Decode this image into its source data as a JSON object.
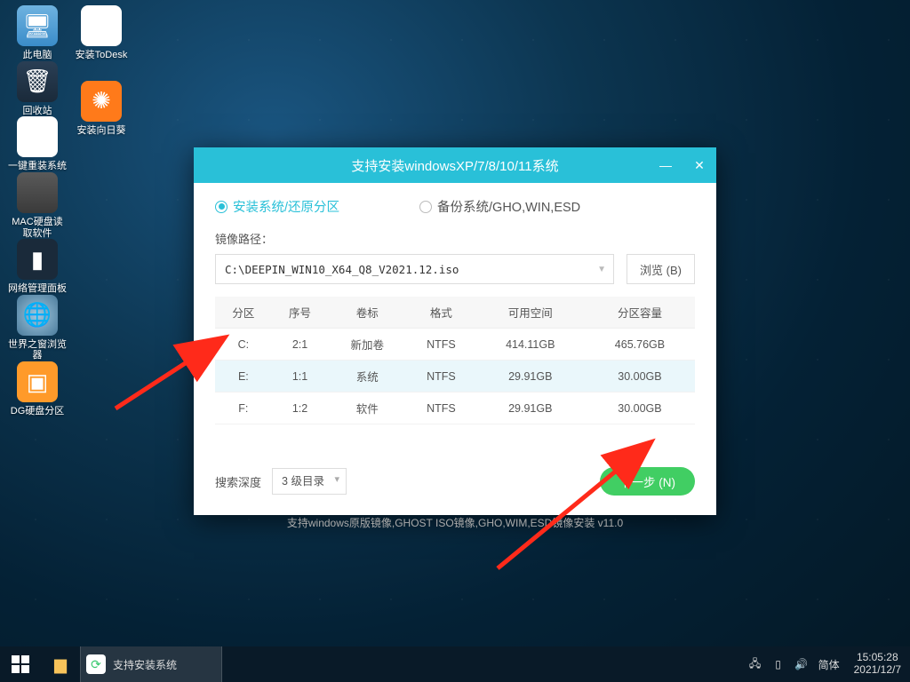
{
  "desktop": {
    "col1": [
      {
        "label": "此电脑",
        "icon": "ic-pc",
        "glyph": "🖥"
      },
      {
        "label": "回收站",
        "icon": "ic-recycle",
        "glyph": "🗑"
      },
      {
        "label": "一键重装系统",
        "icon": "ic-reinstall",
        "glyph": "⟳"
      },
      {
        "label": "MAC硬盘读取软件",
        "icon": "ic-mac",
        "glyph": ""
      },
      {
        "label": "网络管理面板",
        "icon": "ic-netpanel",
        "glyph": "▮"
      },
      {
        "label": "世界之窗浏览器",
        "icon": "ic-browser",
        "glyph": "🌐"
      },
      {
        "label": "DG硬盘分区",
        "icon": "ic-dg",
        "glyph": "▣"
      }
    ],
    "col2": [
      {
        "label": "安装ToDesk",
        "icon": "ic-todesk",
        "glyph": "◪"
      },
      {
        "label": "安装向日葵",
        "icon": "ic-sunflower",
        "glyph": "✺"
      }
    ]
  },
  "installer": {
    "title": "支持安装windowsXP/7/8/10/11系统",
    "radio_install": "安装系统/还原分区",
    "radio_backup": "备份系统/GHO,WIN,ESD",
    "path_label": "镜像路径：",
    "path_value": "C:\\DEEPIN_WIN10_X64_Q8_V2021.12.iso",
    "browse": "浏览 (B)",
    "headers": {
      "part": "分区",
      "index": "序号",
      "vol": "卷标",
      "fmt": "格式",
      "free": "可用空间",
      "cap": "分区容量"
    },
    "rows": [
      {
        "part": "C:",
        "index": "2:1",
        "vol": "新加卷",
        "fmt": "NTFS",
        "free": "414.11GB",
        "cap": "465.76GB",
        "sel": false
      },
      {
        "part": "E:",
        "index": "1:1",
        "vol": "系统",
        "fmt": "NTFS",
        "free": "29.91GB",
        "cap": "30.00GB",
        "sel": true
      },
      {
        "part": "F:",
        "index": "1:2",
        "vol": "软件",
        "fmt": "NTFS",
        "free": "29.91GB",
        "cap": "30.00GB",
        "sel": false
      }
    ],
    "search_depth_label": "搜索深度",
    "search_depth_value": "3 级目录",
    "next": "下一步 (N)",
    "tip": "支持windows原版镜像,GHOST ISO镜像,GHO,WIM,ESD镜像安装 v11.0"
  },
  "taskbar": {
    "task_label": "支持安装系统",
    "ime": "简体",
    "time": "15:05:28",
    "date": "2021/12/7"
  }
}
